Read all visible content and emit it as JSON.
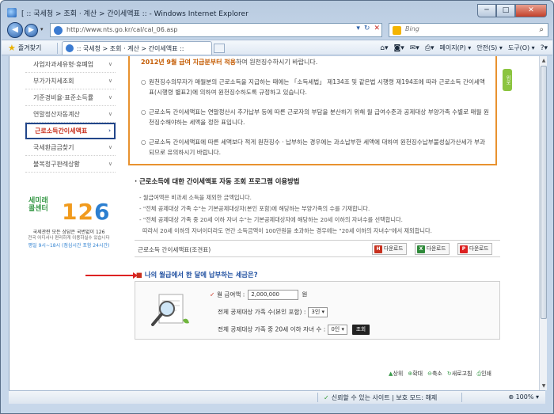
{
  "window": {
    "title": "[ :: 국세청 > 조회 · 계산 > 간이세액표 :: - Windows Internet Explorer",
    "min": "─",
    "max": "□",
    "close": "✕"
  },
  "address": {
    "url": "http://www.nts.go.kr/cal/cal_06.asp",
    "search_placeholder": "Bing"
  },
  "toolbar": {
    "favorites": "즐겨찾기",
    "tab_label": ":: 국세청 > 조회 · 계산 > 간이세액표 ::",
    "page_menu": "페이지(P) ▾",
    "safety_menu": "안전(S) ▾",
    "tools_menu": "도구(O) ▾"
  },
  "sidebar": {
    "items": [
      {
        "label": "사업자과세유형·휴폐업"
      },
      {
        "label": "부가가치세조회"
      },
      {
        "label": "기준경비율·표준소득률"
      },
      {
        "label": "연말정산자동계산"
      },
      {
        "label": "근로소득간이세액표"
      },
      {
        "label": "국세환급금찾기"
      },
      {
        "label": "불복청구판례상황"
      }
    ],
    "ad": {
      "tag": "세미래 콜센터",
      "num_left": "12",
      "num_right": "6",
      "line1": "국세관련 모든 상담은 국번없이 126",
      "line2": "전국 어디서나 편리하게 이용하실수 있습니다",
      "line3": "평일 9시~18시 (점심시간 포함 24시간)"
    }
  },
  "notice": {
    "first_hl": "2012년 9월 급여 지급분부터 적용",
    "first_rest": "하여 원천징수하시기 바랍니다.",
    "b1": "원천징수의무자가 매월분의 근로소득을 지급하는 때에는 「소득세법」 제134조 및 같은법 시행령 제194조에 따라 근로소득 간이세액표(시행령 별표2)에 의하여 원천징수하도록 규정하고 있습니다.",
    "b2": "근로소득 간이세액표는 연말정산시 추가납부 등에 따른 근로자의 부담을 분산하기 위해 월 급여수준과 공제대상 부양가족 수별로 매월 원천징수해야하는 세액을 정한 표입니다.",
    "b3": "근로소득 간이세액표에 따른 세액보다 적게 원천징수 · 납부하는 경우에는 과소납부한 세액에 대하여 원천징수납부불성실가산세가 부과되므로 유의하시기 바랍니다.",
    "side_tab": "위로"
  },
  "guide": {
    "title": "· 근로소득에 대한 간이세액표 자동 조회 프로그램 이용방법",
    "l1": "- 월급여액은 비과세 소득을 제외한 금액입니다.",
    "l2": "- \"전체 공제대상 가족 수\"는 기본공제대상자(본인 포함)에 해당하는 부양가족의 수를 기재합니다.",
    "l3": "- \"전체 공제대상 가족 중 20세 이하 자녀 수\"는 기본공제대상자에 해당하는 20세 이하의 자녀수를 선택합니다.",
    "l4": "따라서 20세 이하의 자녀이더라도 연간 소득금액이 100만원을 초과하는 경우에는 \"20세 이하의 자녀수\"에서 제외합니다."
  },
  "download": {
    "label": "근로소득 간이세액표(조견표)",
    "btn": "다운로드"
  },
  "calc": {
    "title": "나의 월급에서 한 달에 납부하는 세금은?",
    "salary_label": "월 급여액 :",
    "salary_value": "2,000,000",
    "salary_unit": "원",
    "family_label": "전체 공제대상 가족 수(본인 포함) :",
    "family_value": "3인 ▾",
    "child_label": "전체 공제대상 가족 중 20세 이하 자녀 수 :",
    "child_value": "0인 ▾",
    "go": "조회"
  },
  "footer": {
    "top": "상위",
    "zoom_in": "확대",
    "zoom_out": "축소",
    "refresh": "새로고침",
    "print": "인쇄"
  },
  "status": {
    "trust": "신뢰할 수 있는 사이트 | 보호 모드: 해제",
    "zoom": "100%"
  }
}
